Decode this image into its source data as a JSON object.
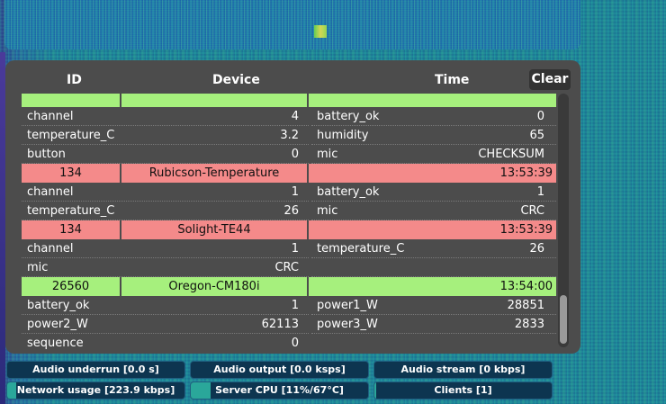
{
  "table": {
    "headers": {
      "id": "ID",
      "device": "Device",
      "time": "Time"
    },
    "clear_label": "Clear",
    "rows": [
      {
        "type": "hdr",
        "color": "green",
        "id": "",
        "device": "",
        "time": ""
      },
      {
        "type": "kv",
        "k1": "channel",
        "v1": "4",
        "k2": "battery_ok",
        "v2": "0"
      },
      {
        "type": "kv",
        "k1": "temperature_C",
        "v1": "3.2",
        "k2": "humidity",
        "v2": "65"
      },
      {
        "type": "kv",
        "k1": "button",
        "v1": "0",
        "k2": "mic",
        "v2": "CHECKSUM"
      },
      {
        "type": "hdr",
        "color": "red",
        "id": "134",
        "device": "Rubicson-Temperature",
        "time": "13:53:39"
      },
      {
        "type": "kv",
        "k1": "channel",
        "v1": "1",
        "k2": "battery_ok",
        "v2": "1"
      },
      {
        "type": "kv",
        "k1": "temperature_C",
        "v1": "26",
        "k2": "mic",
        "v2": "CRC"
      },
      {
        "type": "hdr",
        "color": "red",
        "id": "134",
        "device": "Solight-TE44",
        "time": "13:53:39"
      },
      {
        "type": "kv",
        "k1": "channel",
        "v1": "1",
        "k2": "temperature_C",
        "v2": "26"
      },
      {
        "type": "kv",
        "k1": "mic",
        "v1": "CRC",
        "k2": "",
        "v2": ""
      },
      {
        "type": "hdr",
        "color": "green",
        "id": "26560",
        "device": "Oregon-CM180i",
        "time": "13:54:00"
      },
      {
        "type": "kv",
        "k1": "battery_ok",
        "v1": "1",
        "k2": "power1_W",
        "v2": "28851"
      },
      {
        "type": "kv",
        "k1": "power2_W",
        "v1": "62113",
        "k2": "power3_W",
        "v2": "2833"
      },
      {
        "type": "kv",
        "k1": "sequence",
        "v1": "0",
        "k2": "",
        "v2": ""
      }
    ]
  },
  "status": {
    "audio_underrun": {
      "label": "Audio underrun [0.0 s]",
      "level": 0
    },
    "audio_output": {
      "label": "Audio output [0.0 ksps]",
      "level": 0
    },
    "audio_stream": {
      "label": "Audio stream [0 kbps]",
      "level": 0
    },
    "network_usage": {
      "label": "Network usage [223.9 kbps]",
      "level": 0.05
    },
    "server_cpu": {
      "label": "Server CPU [11%/67°C]",
      "level": 0.11
    },
    "clients": {
      "label": "Clients [1]",
      "level": 0.01
    }
  },
  "colors": {
    "red_row": "#f48a8a",
    "green_row": "#a6f07d",
    "panel": "#4c4c4c",
    "status_bg": "#0d3550",
    "status_fill": "#2aa79a"
  }
}
